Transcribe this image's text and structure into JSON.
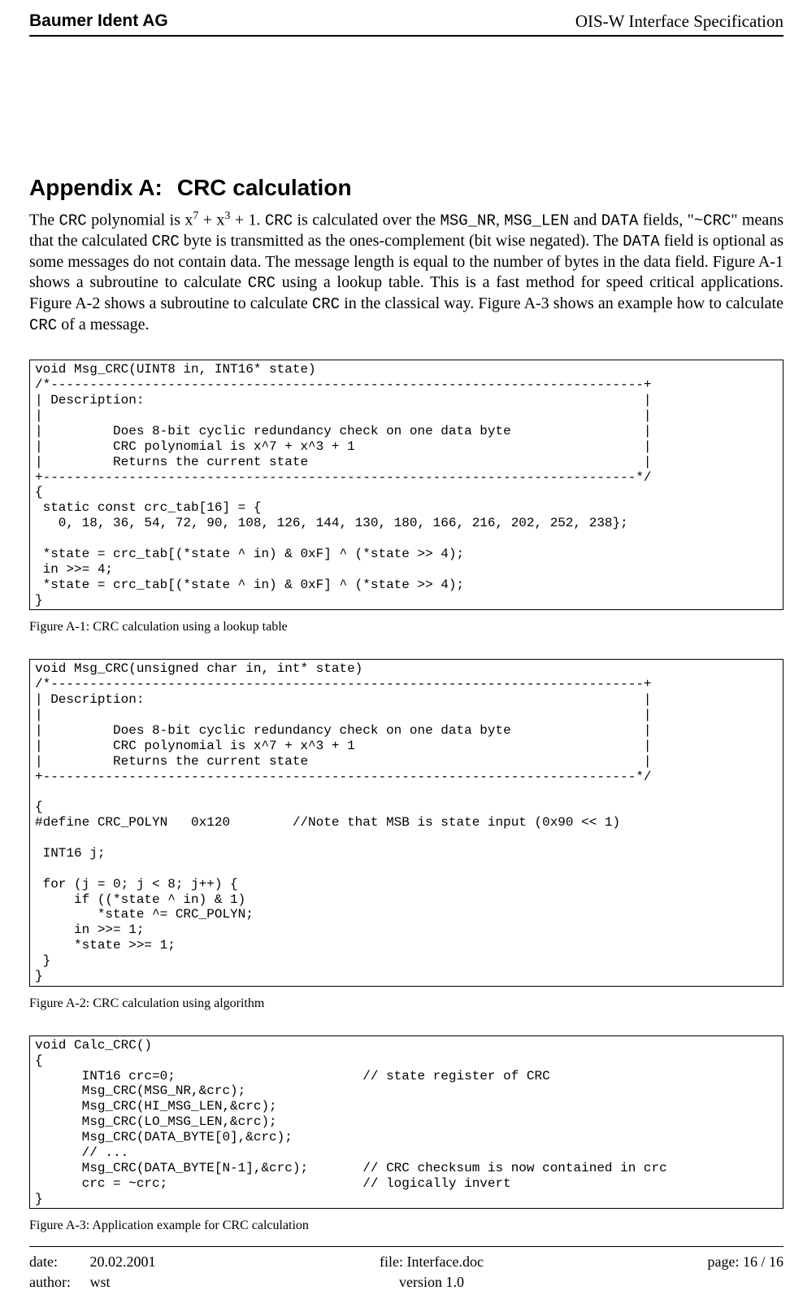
{
  "header": {
    "left": "Baumer Ident AG",
    "right": "OIS-W Interface Specification"
  },
  "heading": {
    "label": "Appendix A:",
    "title": "CRC calculation"
  },
  "paragraph": {
    "p1a": "The ",
    "p1b": "CRC",
    "p1c": " polynomial is x",
    "p1d": "7",
    "p1e": " + x",
    "p1f": "3",
    "p1g": " + 1. ",
    "p1h": "CRC",
    "p1i": " is calculated over the ",
    "p1j": "MSG_NR",
    "p1k": ", ",
    "p1l": "MSG_LEN",
    "p1m": " and ",
    "p1n": "DATA",
    "p1o": " fields, \"",
    "p1p": "~CRC",
    "p1q": "\" means that the calculated ",
    "p1r": "CRC",
    "p1s": " byte is transmitted as the ones-complement (bit wise negated). The ",
    "p1t": "DATA",
    "p1u": " field is optional as some messages do not contain data. The message length is equal to the number of bytes in the data field. Figure A-1 shows a subroutine to calculate ",
    "p1v": "CRC",
    "p1w": " using a lookup table. This is a fast method for speed critical applications. Figure A-2 shows a subroutine to calculate ",
    "p1x": "CRC",
    "p1y": " in the classical way. Figure A-3 shows an example how to calculate ",
    "p1z": "CRC",
    "p1za": " of a message."
  },
  "code1": "void Msg_CRC(UINT8 in, INT16* state)\n/*----------------------------------------------------------------------------+\n| Description:                                                                |\n|                                                                             |\n|         Does 8-bit cyclic redundancy check on one data byte                 |\n|         CRC polynomial is x^7 + x^3 + 1                                     |\n|         Returns the current state                                           |\n+----------------------------------------------------------------------------*/\n{\n static const crc_tab[16] = {\n   0, 18, 36, 54, 72, 90, 108, 126, 144, 130, 180, 166, 216, 202, 252, 238};\n\n *state = crc_tab[(*state ^ in) & 0xF] ^ (*state >> 4);\n in >>= 4;\n *state = crc_tab[(*state ^ in) & 0xF] ^ (*state >> 4);\n}",
  "caption1": "Figure A-1: CRC calculation using a lookup table",
  "code2": "void Msg_CRC(unsigned char in, int* state)\n/*----------------------------------------------------------------------------+\n| Description:                                                                |\n|                                                                             |\n|         Does 8-bit cyclic redundancy check on one data byte                 |\n|         CRC polynomial is x^7 + x^3 + 1                                     |\n|         Returns the current state                                           |\n+----------------------------------------------------------------------------*/\n\n{\n#define CRC_POLYN   0x120        //Note that MSB is state input (0x90 << 1)\n\n INT16 j;\n\n for (j = 0; j < 8; j++) {\n     if ((*state ^ in) & 1)\n        *state ^= CRC_POLYN;\n     in >>= 1;\n     *state >>= 1;\n }\n}",
  "caption2": "Figure A-2: CRC calculation using algorithm",
  "code3": "void Calc_CRC()\n{\n      INT16 crc=0;                        // state register of CRC\n      Msg_CRC(MSG_NR,&crc);\n      Msg_CRC(HI_MSG_LEN,&crc);\n      Msg_CRC(LO_MSG_LEN,&crc);\n      Msg_CRC(DATA_BYTE[0],&crc);\n      // ...\n      Msg_CRC(DATA_BYTE[N-1],&crc);       // CRC checksum is now contained in crc\n      crc = ~crc;                         // logically invert\n}",
  "caption3": "Figure A-3: Application example for CRC calculation",
  "footer": {
    "date_label": "date:",
    "date": "20.02.2001",
    "author_label": "author:",
    "author": "wst",
    "file_label": "file: Interface.doc",
    "version_label": "version 1.0",
    "page_label": "page: 16 / 16"
  }
}
